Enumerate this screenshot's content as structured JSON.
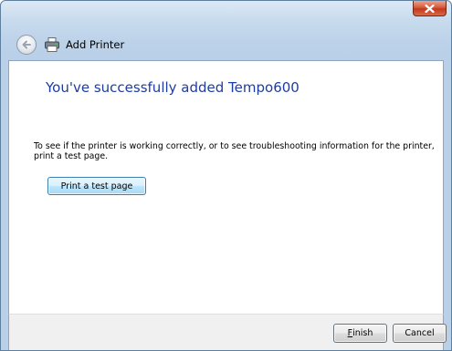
{
  "window": {
    "title": "Add Printer"
  },
  "icons": {
    "back": "back-arrow-icon",
    "printer": "printer-icon",
    "close": "close-icon"
  },
  "content": {
    "heading": "You've successfully added Tempo600",
    "info_text": "To see if the printer is working correctly, or to see troubleshooting information for the printer, print a test page.",
    "print_test_label": "Print a test page"
  },
  "footer": {
    "finish_mnemonic": "F",
    "finish_rest": "inish",
    "cancel_label": "Cancel"
  },
  "colors": {
    "heading": "#1e3d9e",
    "close_button": "#c3391c",
    "frame": "#bcd2e9"
  }
}
